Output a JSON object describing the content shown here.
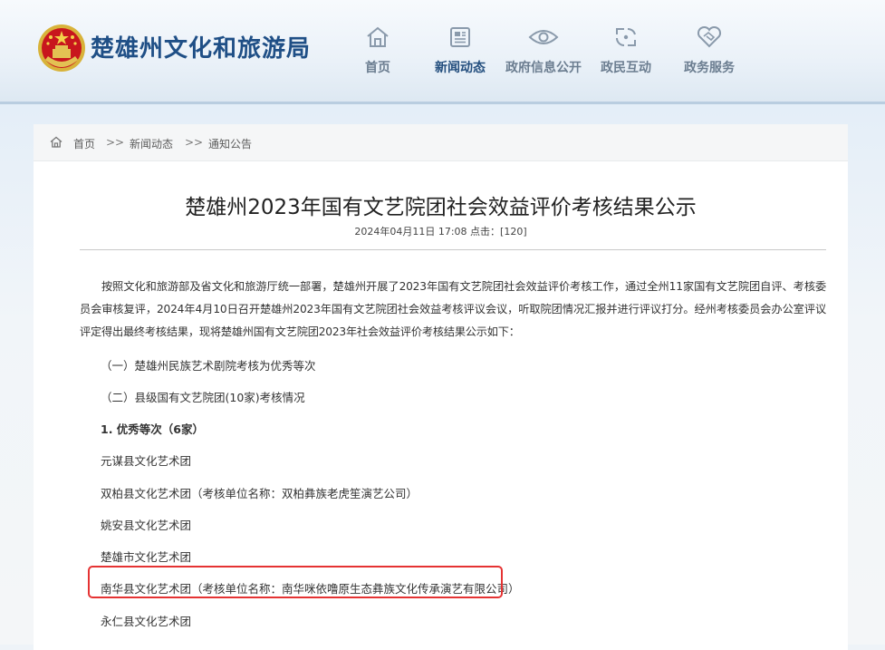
{
  "header": {
    "site_title": "楚雄州文化和旅游局",
    "nav": [
      {
        "label": "首页",
        "icon": "home-icon"
      },
      {
        "label": "新闻动态",
        "icon": "news-icon",
        "active": true
      },
      {
        "label": "政府信息公开",
        "icon": "eye-icon"
      },
      {
        "label": "政民互动",
        "icon": "interaction-icon"
      },
      {
        "label": "政务服务",
        "icon": "handshake-icon"
      }
    ]
  },
  "breadcrumb": {
    "items": [
      "首页",
      "新闻动态",
      "通知公告"
    ],
    "separator": ">>"
  },
  "article": {
    "title": "楚雄州2023年国有文艺院团社会效益评价考核结果公示",
    "meta": "2024年04月11日 17:08  点击：[120]",
    "intro": "按照文化和旅游部及省文化和旅游厅统一部署，楚雄州开展了2023年国有文艺院团社会效益评价考核工作，通过全州11家国有文艺院团自评、考核委员会审核复评，2024年4月10日召开楚雄州2023年国有文艺院团社会效益考核评议会议，听取院团情况汇报并进行评议打分。经州考核委员会办公室评议评定得出最终考核结果，现将楚雄州国有文艺院团2023年社会效益评价考核结果公示如下：",
    "paragraphs": [
      "（一）楚雄州民族艺术剧院考核为优秀等次",
      "（二）县级国有文艺院团(10家)考核情况",
      "1. 优秀等次（6家）",
      "元谋县文化艺术团",
      "双柏县文化艺术团（考核单位名称：双柏彝族老虎笙演艺公司）",
      "姚安县文化艺术团",
      "楚雄市文化艺术团",
      "南华县文化艺术团（考核单位名称：南华咪依噜原生态彝族文化传承演艺有限公司）",
      "永仁县文化艺术团"
    ]
  },
  "colors": {
    "title_blue": "#1f4f86",
    "highlight_red": "#e53333"
  }
}
